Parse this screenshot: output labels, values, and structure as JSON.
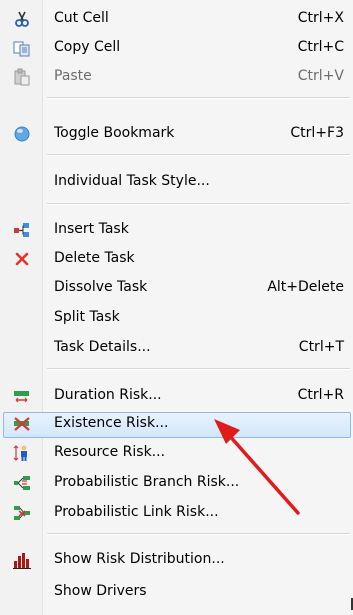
{
  "menu": {
    "items": [
      {
        "label": "Cut Cell",
        "shortcut": "Ctrl+X",
        "icon": "scissors-icon"
      },
      {
        "label": "Copy Cell",
        "shortcut": "Ctrl+C",
        "icon": "copy-icon"
      },
      {
        "label": "Paste",
        "shortcut": "Ctrl+V",
        "icon": "paste-icon",
        "disabled": true
      },
      {
        "label": "Toggle Bookmark",
        "shortcut": "Ctrl+F3",
        "icon": "bookmark-icon"
      },
      {
        "label": "Individual Task Style...",
        "shortcut": ""
      },
      {
        "label": "Insert Task",
        "shortcut": "",
        "icon": "insert-task-icon"
      },
      {
        "label": "Delete Task",
        "shortcut": "",
        "icon": "delete-x-icon"
      },
      {
        "label": "Dissolve Task",
        "shortcut": "Alt+Delete"
      },
      {
        "label": "Split Task",
        "shortcut": ""
      },
      {
        "label": "Task Details...",
        "shortcut": "Ctrl+T"
      },
      {
        "label": "Duration Risk...",
        "shortcut": "Ctrl+R",
        "icon": "duration-risk-icon"
      },
      {
        "label": "Existence Risk...",
        "shortcut": "",
        "icon": "existence-risk-icon",
        "highlighted": true
      },
      {
        "label": "Resource Risk...",
        "shortcut": "",
        "icon": "resource-risk-icon"
      },
      {
        "label": "Probabilistic Branch Risk...",
        "shortcut": "",
        "icon": "branch-risk-icon"
      },
      {
        "label": "Probabilistic Link Risk...",
        "shortcut": "",
        "icon": "link-risk-icon"
      },
      {
        "label": "Show Risk Distribution...",
        "shortcut": "",
        "icon": "histogram-icon"
      },
      {
        "label": "Show Drivers",
        "shortcut": ""
      }
    ]
  },
  "colors": {
    "highlight_border": "#8fb9e8",
    "highlight_fill": "#d3e7fb",
    "arrow": "#e11a1a"
  }
}
